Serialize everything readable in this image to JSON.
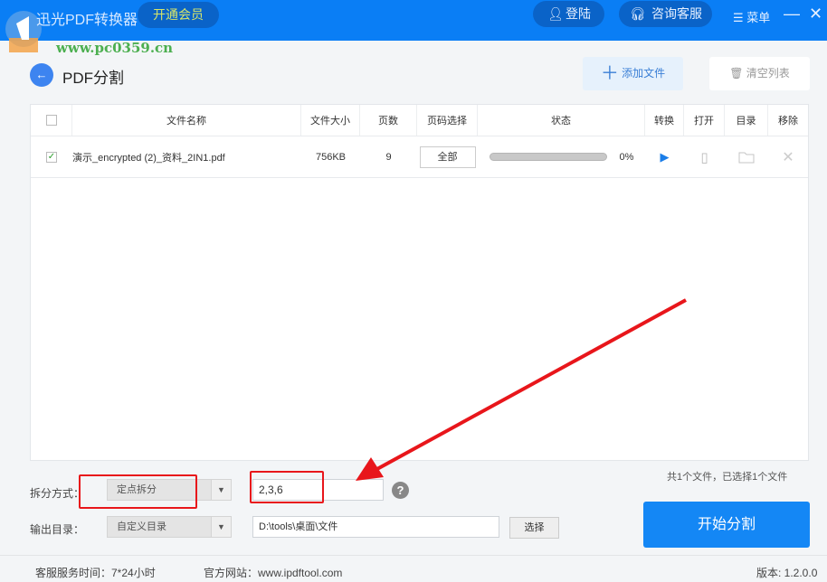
{
  "app": {
    "title": "迅光PDF转换器",
    "vip": "开通会员",
    "login": "登陆",
    "support": "咨询客服",
    "menu": "菜单",
    "minimize": "—",
    "close": "✕",
    "watermark": "www.pc0359.cn"
  },
  "page": {
    "title": "PDF分割",
    "add_file": "添加文件",
    "clear_list": "清空列表"
  },
  "table": {
    "headers": [
      "文件名称",
      "文件大小",
      "页数",
      "页码选择",
      "状态",
      "转换",
      "打开",
      "目录",
      "移除"
    ],
    "rows": [
      {
        "checked": true,
        "name": "演示_encrypted (2)_资料_2IN1.pdf",
        "size": "756KB",
        "pages": "9",
        "range": "全部",
        "progress": 0,
        "progress_label": "0%"
      }
    ]
  },
  "summary": "共1个文件，已选择1个文件",
  "options": {
    "split_label": "拆分方式：",
    "split_mode": "定点拆分",
    "split_value": "2,3,6",
    "output_label": "输出目录：",
    "output_mode": "自定义目录",
    "output_path": "D:\\tools\\桌面\\文件",
    "choose": "选择",
    "help": "?"
  },
  "start": "开始分割",
  "footer": {
    "hours": "客服服务时间：7*24小时",
    "site": "官方网站：www.ipdftool.com",
    "version": "版本: 1.2.0.0"
  },
  "colors": {
    "primary": "#0a7ef5",
    "annotation": "#e8161b"
  }
}
